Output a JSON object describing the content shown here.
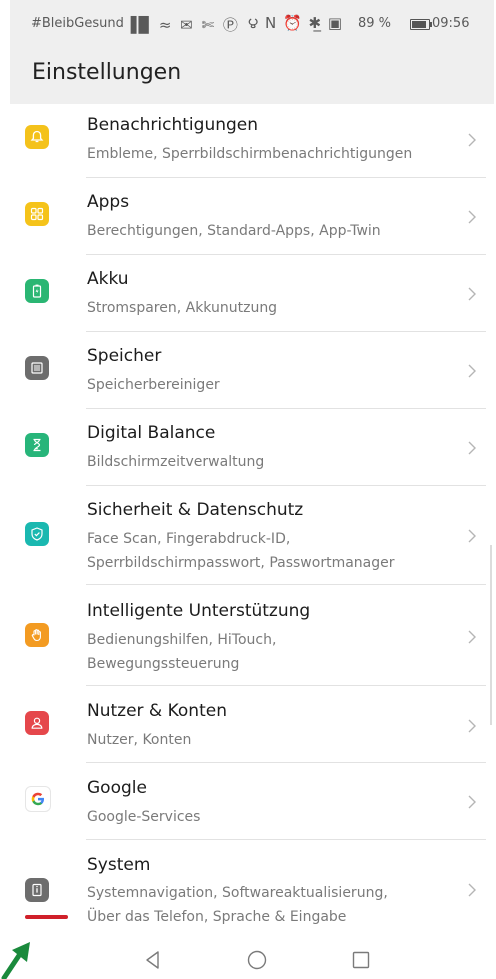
{
  "status_bar": {
    "carrier_text": "#BleibGesund",
    "left_icons": "▐▉ ≈ ✉ ✄ Ⓟ",
    "right_icons": "౪ N ⏰ ✱̲ ▣",
    "battery_text": "89 %",
    "time": "09:56"
  },
  "header": {
    "title": "Einstellungen"
  },
  "colors": {
    "notifications": "#f4c21b",
    "apps": "#f5c31a",
    "battery": "#2ab673",
    "storage": "#6d6d6d",
    "digital_balance": "#27b57a",
    "security": "#1ab8b0",
    "assistance": "#f39b22",
    "accounts": "#e5474b",
    "google": "#ffffff",
    "system": "#6d6d6d"
  },
  "settings": [
    {
      "id": "notifications",
      "icon": "bell-icon",
      "title": "Benachrichtigungen",
      "subtitle_lines": [
        "Embleme, Sperrbildschirmbenachrichtigungen"
      ]
    },
    {
      "id": "apps",
      "icon": "apps-grid-icon",
      "title": "Apps",
      "subtitle_lines": [
        "Berechtigungen, Standard-Apps, App-Twin"
      ]
    },
    {
      "id": "battery",
      "icon": "battery-icon",
      "title": "Akku",
      "subtitle_lines": [
        "Stromsparen, Akkunutzung"
      ]
    },
    {
      "id": "storage",
      "icon": "storage-icon",
      "title": "Speicher",
      "subtitle_lines": [
        "Speicherbereiniger"
      ]
    },
    {
      "id": "digital_balance",
      "icon": "hourglass-icon",
      "title": "Digital Balance",
      "subtitle_lines": [
        "Bildschirmzeitverwaltung"
      ]
    },
    {
      "id": "security",
      "icon": "shield-icon",
      "title": "Sicherheit & Datenschutz",
      "subtitle_lines": [
        "Face Scan, Fingerabdruck-ID,",
        "Sperrbildschirmpasswort, Passwortmanager"
      ]
    },
    {
      "id": "assistance",
      "icon": "hand-icon",
      "title": "Intelligente Unterstützung",
      "subtitle_lines": [
        "Bedienungshilfen, HiTouch,",
        "Bewegungssteuerung"
      ]
    },
    {
      "id": "accounts",
      "icon": "user-icon",
      "title": "Nutzer & Konten",
      "subtitle_lines": [
        "Nutzer, Konten"
      ]
    },
    {
      "id": "google",
      "icon": "google-icon",
      "title": "Google",
      "subtitle_lines": [
        "Google-Services"
      ]
    },
    {
      "id": "system",
      "icon": "system-info-icon",
      "title": "System",
      "subtitle_lines": [
        "Systemnavigation, Softwareaktualisierung,",
        "Über das Telefon, Sprache & Eingabe"
      ]
    }
  ],
  "nav": {
    "back_icon": "back-triangle-icon",
    "home_icon": "home-circle-icon",
    "recents_icon": "recents-square-icon"
  }
}
